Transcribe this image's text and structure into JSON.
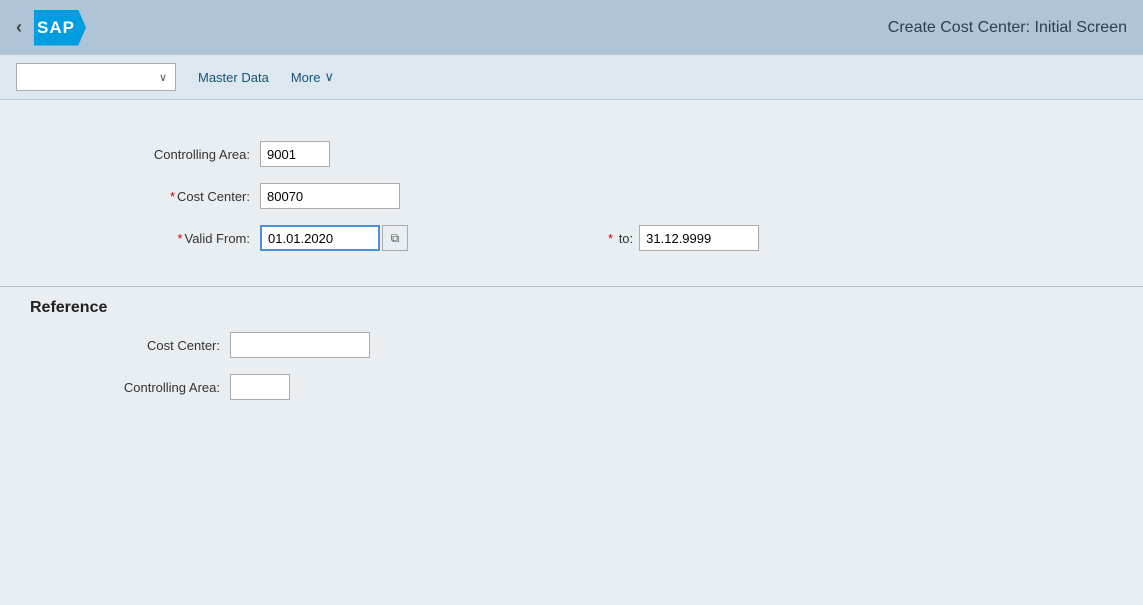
{
  "header": {
    "title": "Create Cost Center: Initial Screen",
    "back_label": "‹"
  },
  "logo": {
    "text": "SAP"
  },
  "toolbar": {
    "select_placeholder": "",
    "menu_items": [
      {
        "id": "master-data",
        "label": "Master Data"
      },
      {
        "id": "more",
        "label": "More"
      }
    ],
    "chevron": "∨"
  },
  "form": {
    "controlling_area_label": "Controlling Area:",
    "controlling_area_value": "9001",
    "cost_center_label": "Cost Center:",
    "cost_center_value": "80070",
    "valid_from_label": "Valid From:",
    "valid_from_value": "01.01.2020",
    "valid_to_label": "to:",
    "valid_to_value": "31.12.9999",
    "calendar_icon": "⧉"
  },
  "reference": {
    "title": "Reference",
    "cost_center_label": "Cost Center:",
    "cost_center_value": "",
    "controlling_area_label": "Controlling Area:",
    "controlling_area_value": ""
  }
}
